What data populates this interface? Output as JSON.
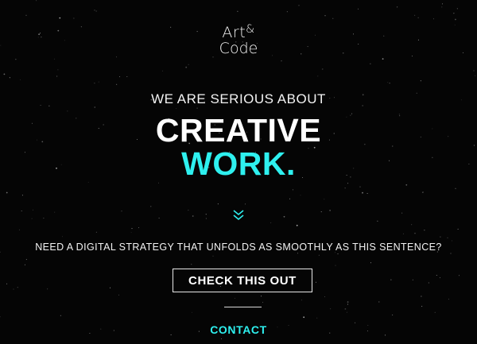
{
  "logo": {
    "line1": "Art",
    "amp": "&",
    "line2": "Code"
  },
  "hero": {
    "tagline": "WE ARE SERIOUS ABOUT",
    "headline_line1": "CREATIVE",
    "headline_line2": "WORK."
  },
  "scroll_icon": "double-chevron-down-icon",
  "cta": {
    "question": "NEED A DIGITAL STRATEGY THAT UNFOLDS AS SMOOTHLY AS THIS SENTENCE?",
    "button_label": "CHECK THIS OUT"
  },
  "nav": {
    "contact_label": "CONTACT"
  },
  "colors": {
    "background": "#050505",
    "accent": "#2ef0ef",
    "text": "#ffffff"
  }
}
